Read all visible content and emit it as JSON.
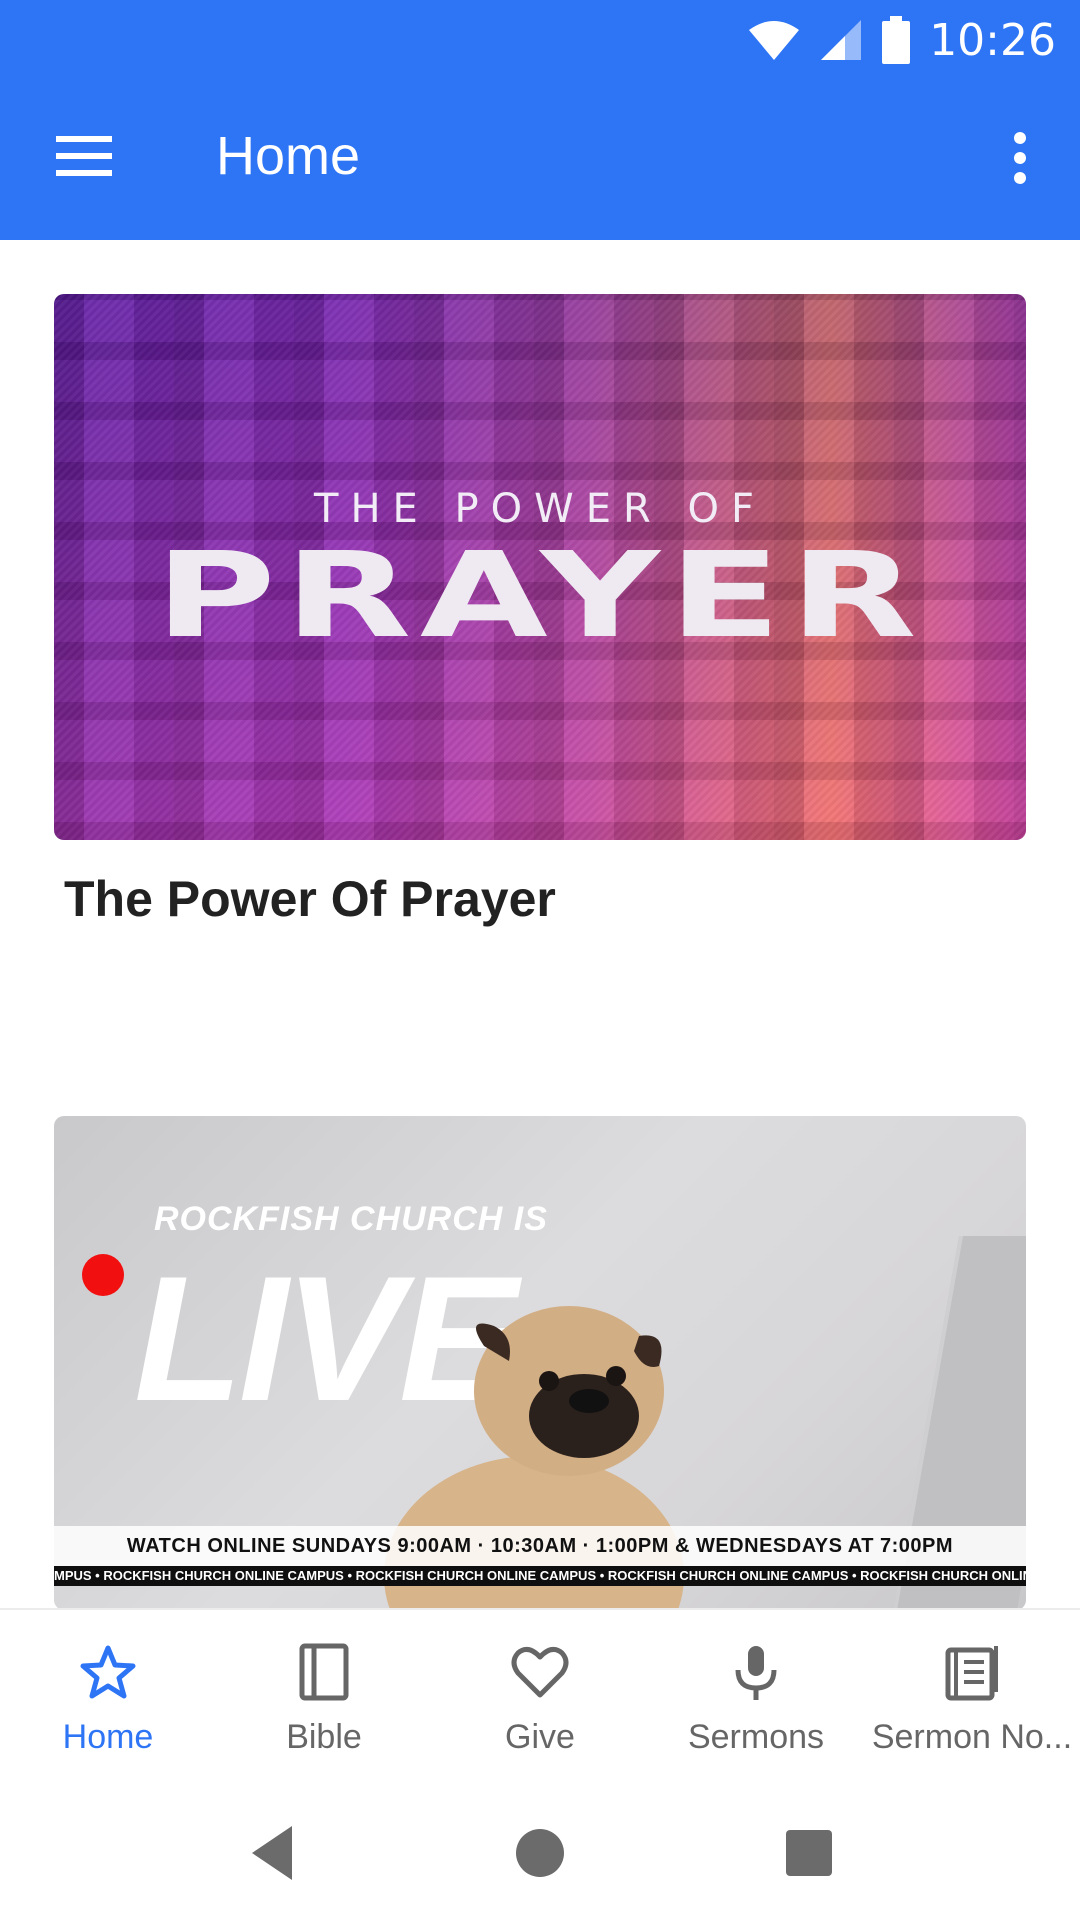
{
  "status_bar": {
    "time": "10:26"
  },
  "app_bar": {
    "title": "Home"
  },
  "cards": [
    {
      "image_kicker": "THE POWER OF",
      "image_title": "PRAYER",
      "title": "The Power Of Prayer"
    },
    {
      "image_kicker": "ROCKFISH CHURCH IS",
      "image_title": "LIVE",
      "banner": "WATCH ONLINE SUNDAYS 9:00AM · 10:30AM · 1:00PM & WEDNESDAYS AT 7:00PM",
      "ticker": "MPUS • ROCKFISH CHURCH ONLINE CAMPUS • ROCKFISH CHURCH ONLINE CAMPUS • ROCKFISH CHURCH ONLINE CAMPUS • ROCKFISH CHURCH ONLINE CAMPUS • ROCKFI"
    }
  ],
  "bottom_nav": {
    "items": [
      {
        "label": "Home",
        "icon": "star-icon",
        "active": true
      },
      {
        "label": "Bible",
        "icon": "book-icon",
        "active": false
      },
      {
        "label": "Give",
        "icon": "heart-icon",
        "active": false
      },
      {
        "label": "Sermons",
        "icon": "microphone-icon",
        "active": false
      },
      {
        "label": "Sermon No...",
        "icon": "notes-icon",
        "active": false
      }
    ]
  },
  "colors": {
    "accent": "#2e75f6",
    "live_dot": "#f20f0f",
    "inactive": "#666666"
  }
}
